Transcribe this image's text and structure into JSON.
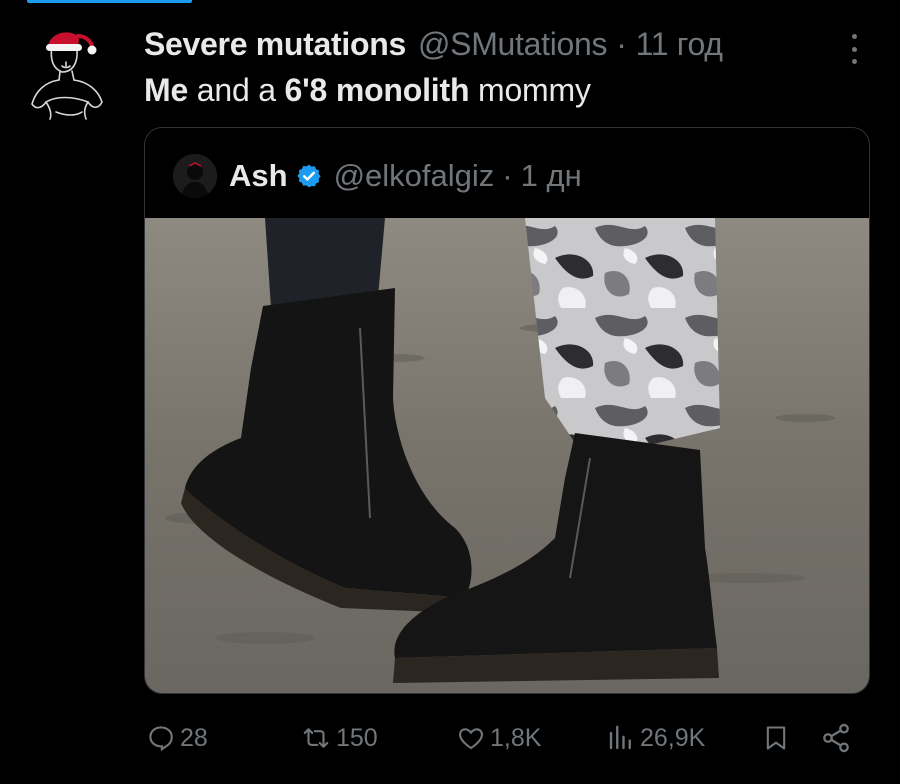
{
  "tweet": {
    "author_name": "Severe mutations",
    "author_handle": "@SMutations",
    "separator": "·",
    "time": "11 год",
    "text_parts": [
      "Me",
      " and a ",
      "6'8 monolith",
      " mommy"
    ]
  },
  "quoted": {
    "author_name": "Ash",
    "author_handle": "@elkofalgiz",
    "separator": "·",
    "time": "1 дн"
  },
  "actions": {
    "replies": "28",
    "retweets": "150",
    "likes": "1,8K",
    "views": "26,9K"
  },
  "colors": {
    "background": "#000000",
    "text": "#e7e9ea",
    "muted": "#71767b",
    "verified": "#1d9bf0",
    "border": "#2f3336"
  }
}
